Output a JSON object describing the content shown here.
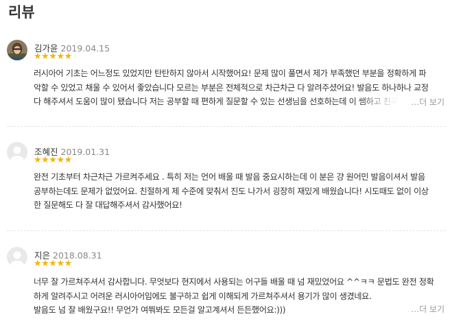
{
  "section_title": "리뷰",
  "colors": {
    "star": "#f5b400",
    "text": "#333333",
    "date": "#888888",
    "more": "#999999"
  },
  "reviews": [
    {
      "author": "김가윤",
      "date": "2019.04.15",
      "stars": "★★★★★",
      "rating": 5,
      "avatar": "profile-photo",
      "lines": [
        "러시아어 기초는 어느정도 있었지만 탄탄하지 않아서 시작했어요! 문제 많이 풀면서 제가 부족했던 부분을 정확하게 파",
        "악할 수 있었고 채울 수 있어서 좋았습니다 모르는 부분은 전체적으로 차근차근 다 알려주셨어요! 발음도 하나하나 교정",
        "다 해주셔서 도움이 많이 됐습니다 저는 공부할 때 편하게 질문할 수 있는 선생님을 선호하는데 이 쌤하고 친구"
      ],
      "more": "…더 보기"
    },
    {
      "author": "조혜진",
      "date": "2019.01.31",
      "stars": "★★★★★",
      "rating": 5,
      "avatar": "default-avatar",
      "lines": [
        "완전 기초부터 차근차근 가르켜주세요 . 특히 저는 언어 배울 때 발음 중요시하는데 이 분은 걍 원어민 발음이셔서 발음",
        "공부하는데도 문제가 없었어요. 친절하게 제 수준에 맞춰서 진도 나가서 굉장히 재밌게 배웠습니다! 시도때도 없이 이상",
        "한 질문해도 다 잘 대답해주셔서 감사했어요!"
      ],
      "more": ""
    },
    {
      "author": "지은",
      "date": "2018.08.31",
      "stars": "★★★★★",
      "rating": 5,
      "avatar": "default-avatar",
      "lines": [
        "너무 잘 가르쳐주셔서 감사합니다. 무엇보다 현지에서 사용되는 어구들 배울 때 넘 재밌었어요 ^^ㅋㅋ 문법도 완전 정확",
        "하게 알려주시고 어려운 러시아어임에도 불구하고 쉽게 이해되게 가르쳐주셔서 용기가 많이 생겼네요.",
        "발음도 넘 잘 배웠구요!! 무언가 여쭤봐도 모든걸 알고계셔서 든든했어요:)))"
      ],
      "more": "…더 보기"
    }
  ]
}
